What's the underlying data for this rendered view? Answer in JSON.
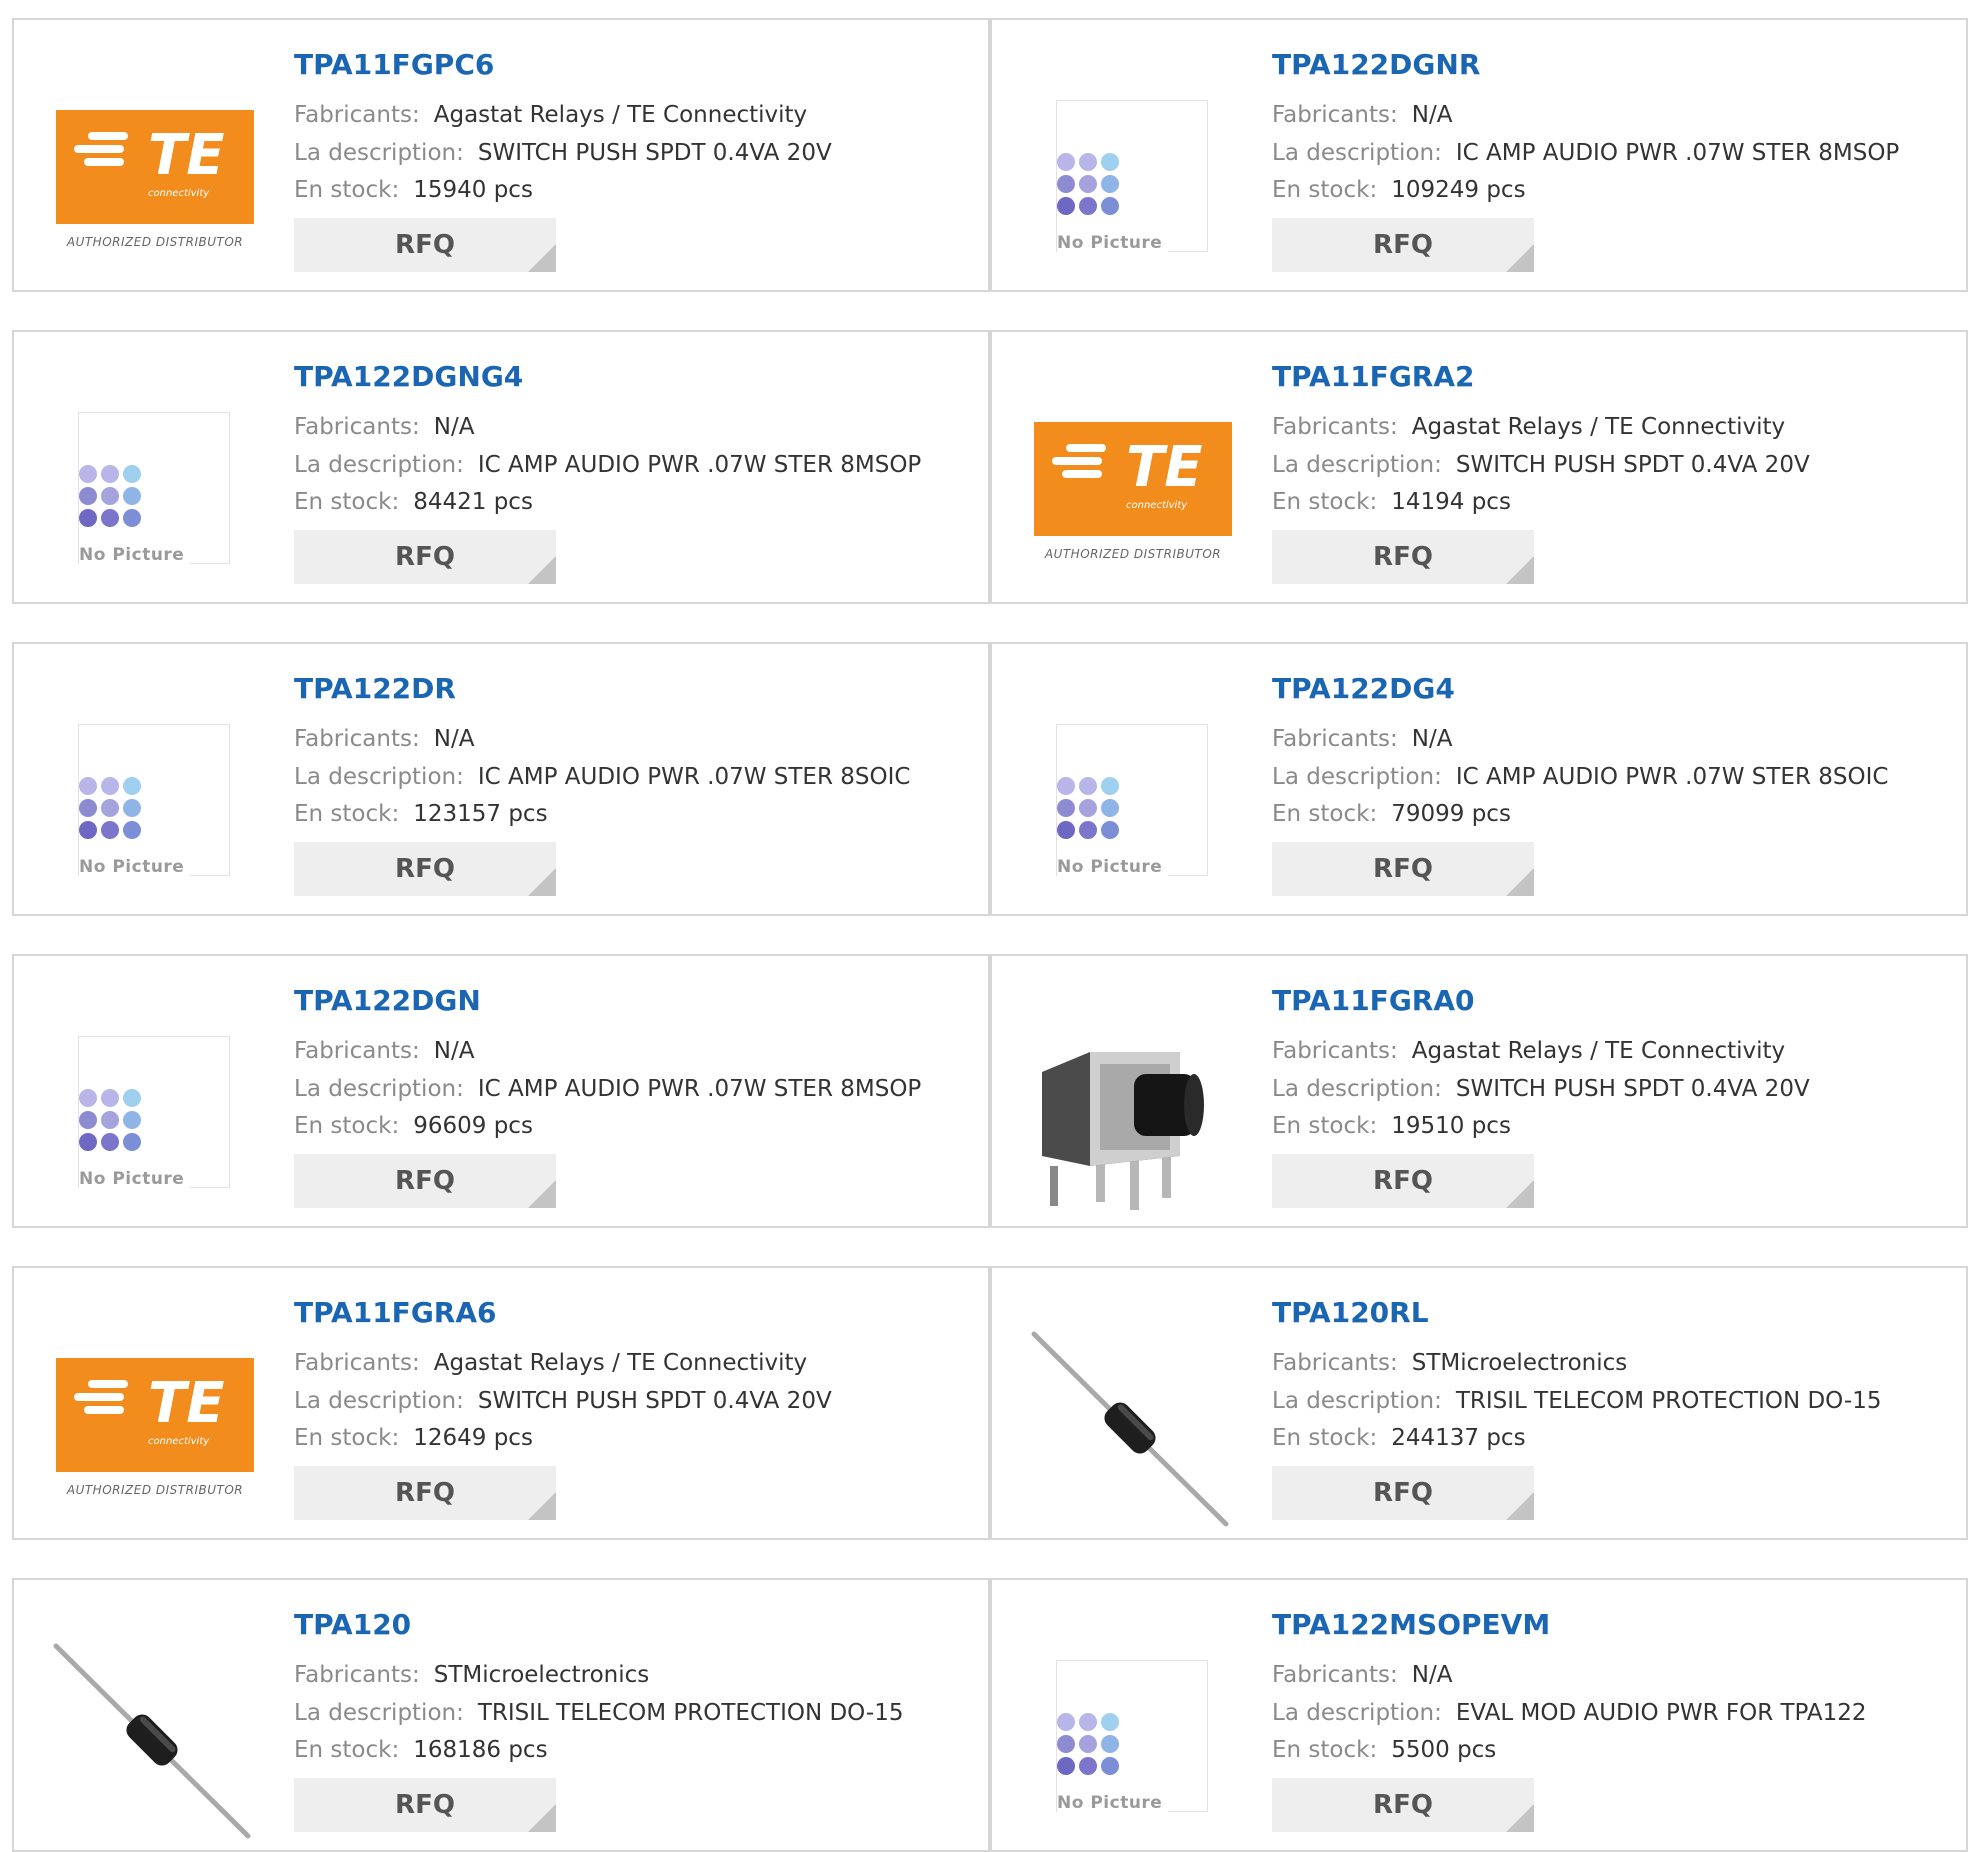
{
  "labels": {
    "manufacturer": "Fabricants:",
    "description": "La description:",
    "stock": "En stock:",
    "rfq": "RFQ"
  },
  "logo": {
    "te_text": "TE",
    "te_sub": "connectivity",
    "authorized": "AUTHORIZED DISTRIBUTOR",
    "brand_color": "#f28c1c"
  },
  "no_picture_text": "No Picture",
  "colors": {
    "part_link": "#1a66b3",
    "label": "#8a8a8a",
    "value": "#333333",
    "rfq_bg": "#eeeeee"
  },
  "products": [
    {
      "part": "TPA11FGPC6",
      "manufacturer": "Agastat Relays / TE Connectivity",
      "description": "SWITCH PUSH SPDT 0.4VA 20V",
      "stock": "15940 pcs",
      "image": "te-logo"
    },
    {
      "part": "TPA122DGNR",
      "manufacturer": "N/A",
      "description": "IC AMP AUDIO PWR .07W STER 8MSOP",
      "stock": "109249 pcs",
      "image": "no-picture"
    },
    {
      "part": "TPA122DGNG4",
      "manufacturer": "N/A",
      "description": "IC AMP AUDIO PWR .07W STER 8MSOP",
      "stock": "84421 pcs",
      "image": "no-picture"
    },
    {
      "part": "TPA11FGRA2",
      "manufacturer": "Agastat Relays / TE Connectivity",
      "description": "SWITCH PUSH SPDT 0.4VA 20V",
      "stock": "14194 pcs",
      "image": "te-logo"
    },
    {
      "part": "TPA122DR",
      "manufacturer": "N/A",
      "description": "IC AMP AUDIO PWR .07W STER 8SOIC",
      "stock": "123157 pcs",
      "image": "no-picture"
    },
    {
      "part": "TPA122DG4",
      "manufacturer": "N/A",
      "description": "IC AMP AUDIO PWR .07W STER 8SOIC",
      "stock": "79099 pcs",
      "image": "no-picture"
    },
    {
      "part": "TPA122DGN",
      "manufacturer": "N/A",
      "description": "IC AMP AUDIO PWR .07W STER 8MSOP",
      "stock": "96609 pcs",
      "image": "no-picture"
    },
    {
      "part": "TPA11FGRA0",
      "manufacturer": "Agastat Relays / TE Connectivity",
      "description": "SWITCH PUSH SPDT 0.4VA 20V",
      "stock": "19510 pcs",
      "image": "push-switch"
    },
    {
      "part": "TPA11FGRA6",
      "manufacturer": "Agastat Relays / TE Connectivity",
      "description": "SWITCH PUSH SPDT 0.4VA 20V",
      "stock": "12649 pcs",
      "image": "te-logo"
    },
    {
      "part": "TPA120RL",
      "manufacturer": "STMicroelectronics",
      "description": "TRISIL TELECOM PROTECTION DO-15",
      "stock": "244137 pcs",
      "image": "diode"
    },
    {
      "part": "TPA120",
      "manufacturer": "STMicroelectronics",
      "description": "TRISIL TELECOM PROTECTION DO-15",
      "stock": "168186 pcs",
      "image": "diode"
    },
    {
      "part": "TPA122MSOPEVM",
      "manufacturer": "N/A",
      "description": "EVAL MOD AUDIO PWR FOR TPA122",
      "stock": "5500 pcs",
      "image": "no-picture"
    }
  ]
}
